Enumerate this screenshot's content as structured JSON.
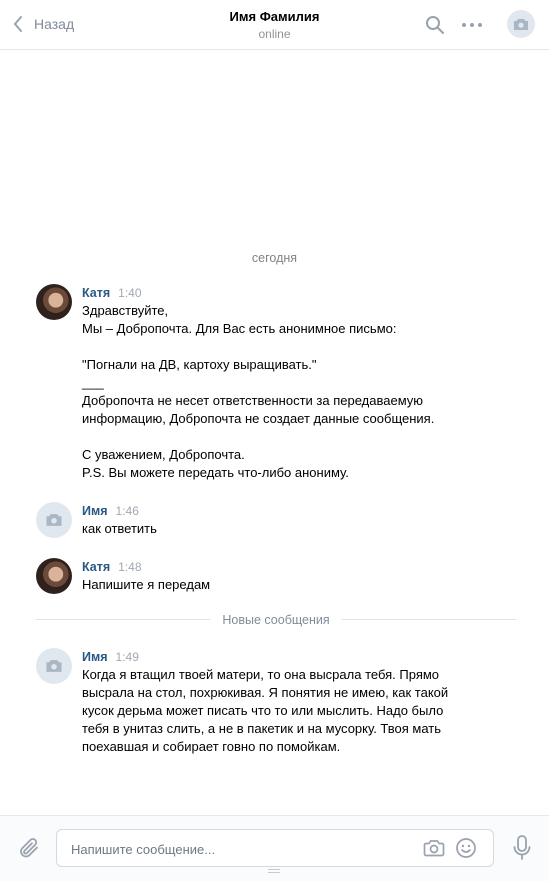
{
  "header": {
    "back_label": "Назад",
    "title": "Имя Фамилия",
    "status": "online"
  },
  "chat": {
    "date_separator": "сегодня",
    "new_messages_label": "Новые сообщения",
    "messages": [
      {
        "author": "Катя",
        "time": "1:40",
        "lines": [
          "Здравствуйте,",
          "Мы – Добропочта. Для Вас есть анонимное письмо:",
          "",
          "\"Погнали на ДВ, картоху выращивать.\"",
          "___",
          "Добропочта не несет ответственности за передаваемую",
          "информацию, Добропочта не создает данные сообщения.",
          "",
          "С уважением, Добропочта.",
          "P.S. Вы можете передать что-либо анониму."
        ]
      },
      {
        "author": "Имя",
        "time": "1:46",
        "lines": [
          "как ответить"
        ]
      },
      {
        "author": "Катя",
        "time": "1:48",
        "lines": [
          "Напишите я передам"
        ]
      },
      {
        "author": "Имя",
        "time": "1:49",
        "lines": [
          "Когда я втащил твоей матери, то она высрала тебя. Прямо",
          "высрала на стол, похрюкивая. Я понятия не имею, как такой",
          "кусок дерьма может писать что то или мыслить. Надо было",
          "тебя в унитаз слить, а не в пакетик и на мусорку. Твоя мать",
          "поехавшая и собирает говно по помойкам."
        ]
      }
    ]
  },
  "composer": {
    "placeholder": "Напишите сообщение..."
  },
  "colors": {
    "link": "#2a5885",
    "icon": "#99a2ad",
    "muted": "#828a99"
  }
}
